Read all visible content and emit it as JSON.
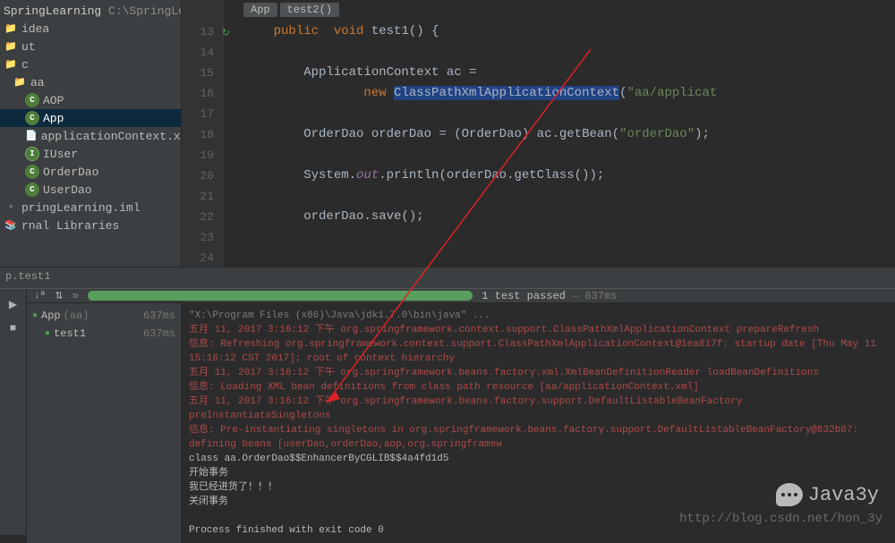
{
  "project": {
    "name": "SpringLearning",
    "path": "C:\\SpringLearning"
  },
  "tree": {
    "items": [
      {
        "label": "idea",
        "indent": 0,
        "icon": "folder"
      },
      {
        "label": "ut",
        "indent": 0,
        "icon": "folder"
      },
      {
        "label": "c",
        "indent": 0,
        "icon": "folder"
      },
      {
        "label": "aa",
        "indent": 1,
        "icon": "folder"
      },
      {
        "label": "AOP",
        "indent": 2,
        "icon": "class"
      },
      {
        "label": "App",
        "indent": 2,
        "icon": "class",
        "selected": true
      },
      {
        "label": "applicationContext.xml",
        "indent": 2,
        "icon": "xml"
      },
      {
        "label": "IUser",
        "indent": 2,
        "icon": "interface"
      },
      {
        "label": "OrderDao",
        "indent": 2,
        "icon": "class"
      },
      {
        "label": "UserDao",
        "indent": 2,
        "icon": "class"
      },
      {
        "label": "pringLearning.iml",
        "indent": 0,
        "icon": "file"
      },
      {
        "label": "rnal Libraries",
        "indent": 0,
        "icon": "lib"
      }
    ]
  },
  "breadcrumb": {
    "items": [
      "App",
      "test2()"
    ]
  },
  "gutter": {
    "start": 13,
    "end": 24
  },
  "code": {
    "l13a": "public",
    "l13b": "  void",
    "l13c": " test1() {",
    "l15a": "ApplicationContext ac =",
    "l16a": "new",
    "l16b": "ClassPathXmlApplicationContext",
    "l16c": "(",
    "l16d": "\"aa/applicat",
    "l18a": "OrderDao orderDao = (OrderDao) ac.getBean(",
    "l18b": "\"orderDao\"",
    "l18c": ");",
    "l20a": "System.",
    "l20b": "out",
    "l20c": ".println(orderDao.getClass());",
    "l22a": "orderDao.save();"
  },
  "testbar": {
    "label": "p.test1"
  },
  "progress": {
    "passed": "1 test passed",
    "time": "637ms"
  },
  "tests": [
    {
      "name": "App",
      "pkg": "(aa)",
      "time": "637ms"
    },
    {
      "name": "test1",
      "pkg": "",
      "time": "637ms"
    }
  ],
  "console": {
    "cmd": "\"X:\\Program Files (x86)\\Java\\jdk1.7.0\\bin\\java\" ...",
    "lines": [
      "五月 11, 2017 3:16:12 下午 org.springframework.context.support.ClassPathXmlApplicationContext prepareRefresh",
      "信息: Refreshing org.springframework.context.support.ClassPathXmlApplicationContext@1ea817f: startup date [Thu May 11 15:16:12 CST 2017]; root of context hierarchy",
      "五月 11, 2017 3:16:12 下午 org.springframework.beans.factory.xml.XmlBeanDefinitionReader loadBeanDefinitions",
      "信息: Loading XML bean definitions from class path resource [aa/applicationContext.xml]",
      "五月 11, 2017 3:16:12 下午 org.springframework.beans.factory.support.DefaultListableBeanFactory preInstantiateSingletons",
      "信息: Pre-instantiating singletons in org.springframework.beans.factory.support.DefaultListableBeanFactory@832b87: defining beans [userDao,orderDao,aop,org.springframew"
    ],
    "out": [
      "class aa.OrderDao$$EnhancerByCGLIB$$4a4fd1d5",
      "开始事务",
      "我已经进货了！！！",
      "关闭事务",
      "",
      "Process finished with exit code 0"
    ]
  },
  "watermark": {
    "name": "Java3y",
    "url": "http://blog.csdn.net/hon_3y"
  }
}
